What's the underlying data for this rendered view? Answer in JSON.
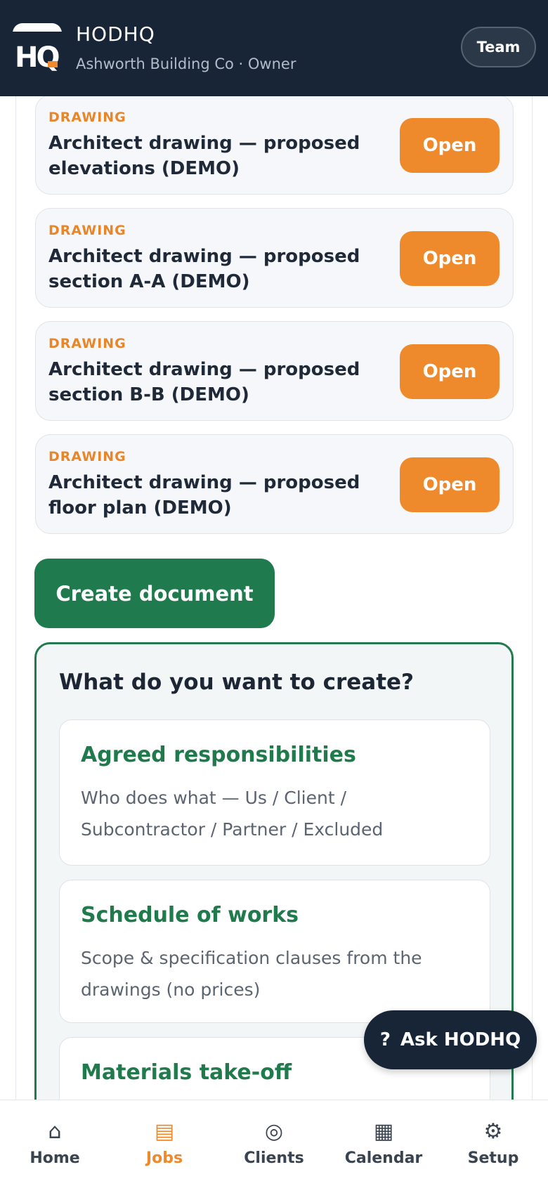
{
  "header": {
    "brand_name": "HODHQ",
    "subtitle": "Ashworth Building Co · Owner",
    "team_label": "Team",
    "logo_text": "HQ"
  },
  "documents": [
    {
      "kind": "DRAWING",
      "title": "Architect drawing — proposed elevations (DEMO)",
      "action": "Open"
    },
    {
      "kind": "DRAWING",
      "title": "Architect drawing — proposed section A-A (DEMO)",
      "action": "Open"
    },
    {
      "kind": "DRAWING",
      "title": "Architect drawing — proposed section B-B (DEMO)",
      "action": "Open"
    },
    {
      "kind": "DRAWING",
      "title": "Architect drawing — proposed floor plan (DEMO)",
      "action": "Open"
    }
  ],
  "create_button": "Create document",
  "create_panel": {
    "title": "What do you want to create?",
    "options": [
      {
        "title": "Agreed responsibilities",
        "description": "Who does what — Us / Client / Subcontractor / Partner / Excluded"
      },
      {
        "title": "Schedule of works",
        "description": "Scope & specification clauses from the drawings (no prices)"
      },
      {
        "title": "Materials take-off",
        "description": ""
      }
    ]
  },
  "ask_button": {
    "icon": "?",
    "label": "Ask HODHQ"
  },
  "nav": [
    {
      "label": "Home",
      "icon": "home-icon",
      "glyph": "⌂",
      "active": false
    },
    {
      "label": "Jobs",
      "icon": "jobs-icon",
      "glyph": "▤",
      "active": true
    },
    {
      "label": "Clients",
      "icon": "clients-icon",
      "glyph": "◎",
      "active": false
    },
    {
      "label": "Calendar",
      "icon": "calendar-icon",
      "glyph": "▦",
      "active": false
    },
    {
      "label": "Setup",
      "icon": "gear-icon",
      "glyph": "⚙",
      "active": false
    }
  ],
  "colors": {
    "header_bg": "#172536",
    "accent_orange": "#ee8a2c",
    "primary_green": "#1f7a4d"
  }
}
